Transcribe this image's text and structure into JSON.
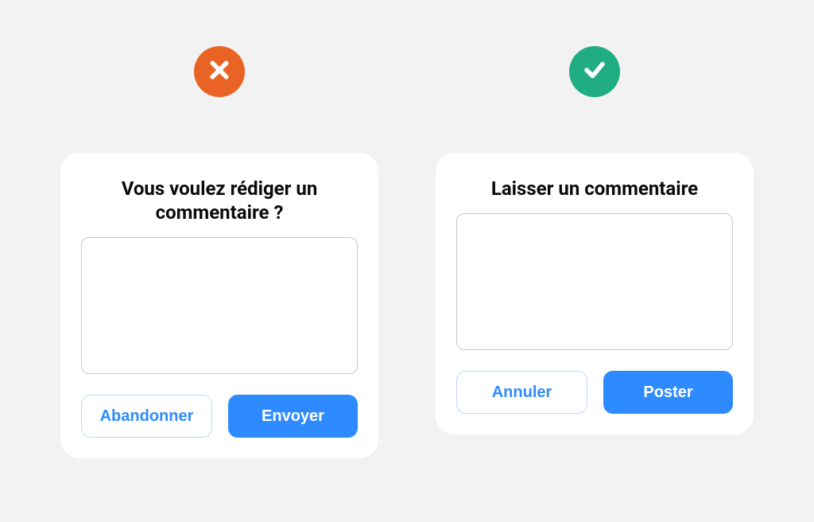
{
  "colors": {
    "bad": "#e96424",
    "good": "#1fad81",
    "primary": "#2e8bff"
  },
  "examples": {
    "bad": {
      "icon": "cross-icon",
      "title": "Vous voulez rédiger un commentaire ?",
      "textarea_value": "",
      "cancel_label": "Abandonner",
      "submit_label": "Envoyer"
    },
    "good": {
      "icon": "check-icon",
      "title": "Laisser un commentaire",
      "textarea_value": "",
      "cancel_label": "Annuler",
      "submit_label": "Poster"
    }
  }
}
